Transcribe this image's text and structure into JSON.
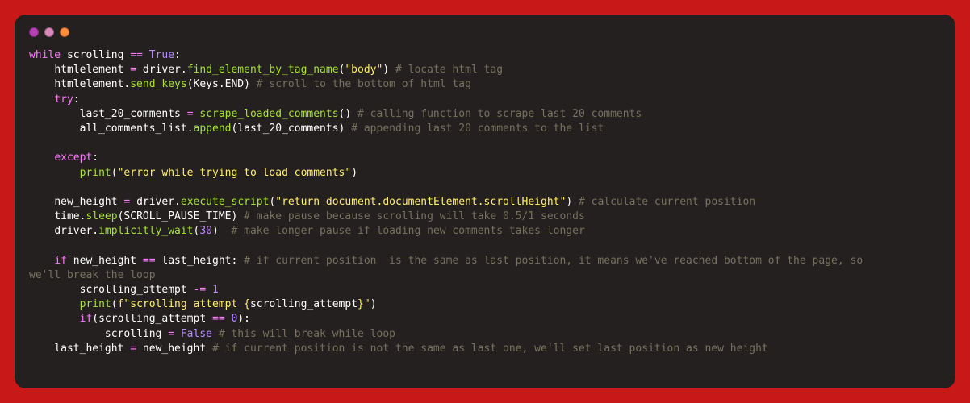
{
  "titlebar": {
    "buttons": [
      "close",
      "minimize",
      "maximize"
    ]
  },
  "code": {
    "lines": [
      {
        "indent": 0,
        "tokens": [
          {
            "t": "kw",
            "v": "while"
          },
          {
            "t": "sp"
          },
          {
            "t": "id",
            "v": "scrolling"
          },
          {
            "t": "sp"
          },
          {
            "t": "op",
            "v": "=="
          },
          {
            "t": "sp"
          },
          {
            "t": "bool",
            "v": "True"
          },
          {
            "t": "paren",
            "v": ":"
          }
        ]
      },
      {
        "indent": 1,
        "tokens": [
          {
            "t": "id",
            "v": "htmlelement"
          },
          {
            "t": "sp"
          },
          {
            "t": "op",
            "v": "="
          },
          {
            "t": "sp"
          },
          {
            "t": "id",
            "v": "driver"
          },
          {
            "t": "dot2",
            "v": "."
          },
          {
            "t": "fn",
            "v": "find_element_by_tag_name"
          },
          {
            "t": "paren",
            "v": "("
          },
          {
            "t": "str",
            "v": "\"body\""
          },
          {
            "t": "paren",
            "v": ")"
          },
          {
            "t": "sp"
          },
          {
            "t": "cm",
            "v": "# locate html tag"
          }
        ]
      },
      {
        "indent": 1,
        "tokens": [
          {
            "t": "id",
            "v": "htmlelement"
          },
          {
            "t": "dot2",
            "v": "."
          },
          {
            "t": "fn",
            "v": "send_keys"
          },
          {
            "t": "paren",
            "v": "("
          },
          {
            "t": "id",
            "v": "Keys"
          },
          {
            "t": "dot2",
            "v": "."
          },
          {
            "t": "id",
            "v": "END"
          },
          {
            "t": "paren",
            "v": ")"
          },
          {
            "t": "sp"
          },
          {
            "t": "cm",
            "v": "# scroll to the bottom of html tag"
          }
        ]
      },
      {
        "indent": 1,
        "tokens": [
          {
            "t": "kw",
            "v": "try"
          },
          {
            "t": "paren",
            "v": ":"
          }
        ]
      },
      {
        "indent": 2,
        "tokens": [
          {
            "t": "id",
            "v": "last_20_comments"
          },
          {
            "t": "sp"
          },
          {
            "t": "op",
            "v": "="
          },
          {
            "t": "sp"
          },
          {
            "t": "fn",
            "v": "scrape_loaded_comments"
          },
          {
            "t": "paren",
            "v": "()"
          },
          {
            "t": "sp"
          },
          {
            "t": "cm",
            "v": "# calling function to scrape last 20 comments"
          }
        ]
      },
      {
        "indent": 2,
        "tokens": [
          {
            "t": "id",
            "v": "all_comments_list"
          },
          {
            "t": "dot2",
            "v": "."
          },
          {
            "t": "fn",
            "v": "append"
          },
          {
            "t": "paren",
            "v": "("
          },
          {
            "t": "id",
            "v": "last_20_comments"
          },
          {
            "t": "paren",
            "v": ")"
          },
          {
            "t": "sp"
          },
          {
            "t": "cm",
            "v": "# appending last 20 comments to the list"
          }
        ]
      },
      {
        "indent": 0,
        "tokens": [
          {
            "t": "sp"
          }
        ]
      },
      {
        "indent": 1,
        "tokens": [
          {
            "t": "kw",
            "v": "except"
          },
          {
            "t": "paren",
            "v": ":"
          }
        ]
      },
      {
        "indent": 2,
        "tokens": [
          {
            "t": "fn",
            "v": "print"
          },
          {
            "t": "paren",
            "v": "("
          },
          {
            "t": "str",
            "v": "\"error while trying to load comments\""
          },
          {
            "t": "paren",
            "v": ")"
          }
        ]
      },
      {
        "indent": 0,
        "tokens": [
          {
            "t": "sp"
          }
        ]
      },
      {
        "indent": 1,
        "tokens": [
          {
            "t": "id",
            "v": "new_height"
          },
          {
            "t": "sp"
          },
          {
            "t": "op",
            "v": "="
          },
          {
            "t": "sp"
          },
          {
            "t": "id",
            "v": "driver"
          },
          {
            "t": "dot2",
            "v": "."
          },
          {
            "t": "fn",
            "v": "execute_script"
          },
          {
            "t": "paren",
            "v": "("
          },
          {
            "t": "str",
            "v": "\"return document.documentElement.scrollHeight\""
          },
          {
            "t": "paren",
            "v": ")"
          },
          {
            "t": "sp"
          },
          {
            "t": "cm",
            "v": "# calculate current position"
          }
        ]
      },
      {
        "indent": 1,
        "tokens": [
          {
            "t": "id",
            "v": "time"
          },
          {
            "t": "dot2",
            "v": "."
          },
          {
            "t": "fn",
            "v": "sleep"
          },
          {
            "t": "paren",
            "v": "("
          },
          {
            "t": "id",
            "v": "SCROLL_PAUSE_TIME"
          },
          {
            "t": "paren",
            "v": ")"
          },
          {
            "t": "sp"
          },
          {
            "t": "cm",
            "v": "# make pause because scrolling will take 0.5/1 seconds"
          }
        ]
      },
      {
        "indent": 1,
        "tokens": [
          {
            "t": "id",
            "v": "driver"
          },
          {
            "t": "dot2",
            "v": "."
          },
          {
            "t": "fn",
            "v": "implicitly_wait"
          },
          {
            "t": "paren",
            "v": "("
          },
          {
            "t": "num",
            "v": "30"
          },
          {
            "t": "paren",
            "v": ")"
          },
          {
            "t": "sp"
          },
          {
            "t": "sp"
          },
          {
            "t": "cm",
            "v": "# make longer pause if loading new comments takes longer"
          }
        ]
      },
      {
        "indent": 0,
        "tokens": [
          {
            "t": "sp"
          }
        ]
      },
      {
        "indent": 1,
        "tokens": [
          {
            "t": "kw",
            "v": "if"
          },
          {
            "t": "sp"
          },
          {
            "t": "id",
            "v": "new_height"
          },
          {
            "t": "sp"
          },
          {
            "t": "op",
            "v": "=="
          },
          {
            "t": "sp"
          },
          {
            "t": "id",
            "v": "last_height"
          },
          {
            "t": "paren",
            "v": ":"
          },
          {
            "t": "sp"
          },
          {
            "t": "cm",
            "v": "# if current position  is the same as last position, it means we've reached bottom of the page, so"
          }
        ]
      },
      {
        "indent": 0,
        "tokens": [
          {
            "t": "cm",
            "v": "we'll break the loop"
          }
        ]
      },
      {
        "indent": 2,
        "tokens": [
          {
            "t": "id",
            "v": "scrolling_attempt"
          },
          {
            "t": "sp"
          },
          {
            "t": "op",
            "v": "-="
          },
          {
            "t": "sp"
          },
          {
            "t": "num",
            "v": "1"
          }
        ]
      },
      {
        "indent": 2,
        "tokens": [
          {
            "t": "fn",
            "v": "print"
          },
          {
            "t": "paren",
            "v": "("
          },
          {
            "t": "str",
            "v": "f\"scrolling attempt "
          },
          {
            "t": "brace",
            "v": "{"
          },
          {
            "t": "id",
            "v": "scrolling_attempt"
          },
          {
            "t": "brace",
            "v": "}"
          },
          {
            "t": "str",
            "v": "\""
          },
          {
            "t": "paren",
            "v": ")"
          }
        ]
      },
      {
        "indent": 2,
        "tokens": [
          {
            "t": "kw",
            "v": "if"
          },
          {
            "t": "paren",
            "v": "("
          },
          {
            "t": "id",
            "v": "scrolling_attempt"
          },
          {
            "t": "sp"
          },
          {
            "t": "op",
            "v": "=="
          },
          {
            "t": "sp"
          },
          {
            "t": "num",
            "v": "0"
          },
          {
            "t": "paren",
            "v": ")"
          },
          {
            "t": "paren",
            "v": ":"
          }
        ]
      },
      {
        "indent": 3,
        "tokens": [
          {
            "t": "id",
            "v": "scrolling"
          },
          {
            "t": "sp"
          },
          {
            "t": "op",
            "v": "="
          },
          {
            "t": "sp"
          },
          {
            "t": "bool",
            "v": "False"
          },
          {
            "t": "sp"
          },
          {
            "t": "cm",
            "v": "# this will break while loop"
          }
        ]
      },
      {
        "indent": 1,
        "tokens": [
          {
            "t": "id",
            "v": "last_height"
          },
          {
            "t": "sp"
          },
          {
            "t": "op",
            "v": "="
          },
          {
            "t": "sp"
          },
          {
            "t": "id",
            "v": "new_height"
          },
          {
            "t": "sp"
          },
          {
            "t": "cm",
            "v": "# if current position is not the same as last one, we'll set last position as new height"
          }
        ]
      }
    ]
  }
}
